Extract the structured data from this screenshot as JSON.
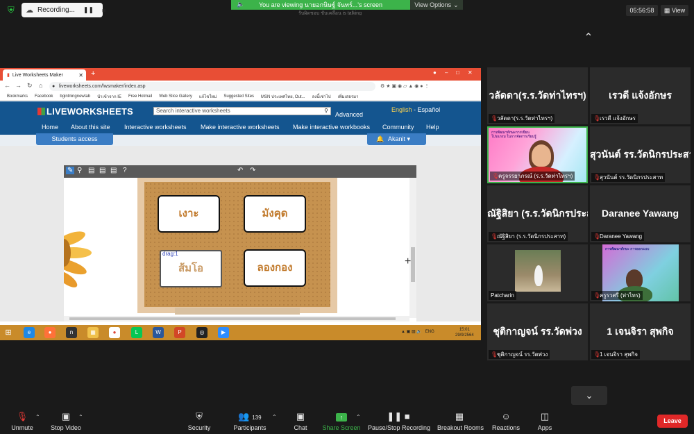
{
  "meeting": {
    "recording_label": "Recording...",
    "viewing_banner": "You are viewing นายอกนิษฐ์ จันทร์...'s screen",
    "view_options_label": "View Options",
    "peek_text": "รับผิดชอบ ขับเคลื่อน is talking",
    "timer": "05:56:58",
    "view_label": "View"
  },
  "browser": {
    "tab_title": "Live Worksheets Maker",
    "url": "liveworksheets.com/lwsmaker/index.asp",
    "bookmarks": [
      "Bookmarks",
      "Facebook",
      "bgintningnewtab",
      "นำเข้าจาก IE",
      "Free Hotmail",
      "Web Slice Gallery",
      "แก้ไขใหม่",
      "Suggested Sites",
      "MSN ประเทศไทย, Out...",
      "ลงนี้เช่าไป",
      "เพิ่มเสอรมา"
    ]
  },
  "site": {
    "logo": "LIVEWORKSHEETS",
    "search_placeholder": "Search interactive worksheets",
    "advanced": "Advanced",
    "lang_english": "English",
    "lang_sep": "-",
    "lang_spanish": "Español",
    "menu": [
      "Home",
      "About this site",
      "Interactive worksheets",
      "Make interactive worksheets",
      "Make interactive workbooks",
      "Community",
      "Help"
    ],
    "students_access": "Students access",
    "user": "Akanit"
  },
  "worksheet": {
    "cards": [
      "เงาะ",
      "มังคุด",
      "ส้มโอ",
      "ลองกอง"
    ],
    "drag_label": "drag:1"
  },
  "taskbar": {
    "tray": "ENG",
    "time": "15:01",
    "date": "29/9/2564"
  },
  "participants_tiles": [
    {
      "name": "วลัดดา(ร.ร.วัดท่าไทรฯ)",
      "caption": "วลัดดา(ร.ร.วัดท่าไทรฯ)"
    },
    {
      "name": "เรวดี แจ้งอักษร",
      "caption": "เรวดี แจ้งอักษร"
    },
    {
      "caption": "ครูจรรยาภรณ์ (ร.ร.วัดท่าไทรฯ)",
      "banner": "การพัฒนาทักษะการเขียนโปรแกรม ในการจัดการเรียนรู้"
    },
    {
      "name": "สุวนันต์ รร.วัดนิกรประสาท",
      "caption": "สุวนันต์ รร.วัดนิกรประสาท"
    },
    {
      "name": "ณัฐิสิยา (ร.ร.วัดนิกรประสาท)",
      "caption": "ณัฐิสิยา (ร.ร.วัดนิกรประสาท)"
    },
    {
      "name": "Daranee Yawang",
      "caption": "Daranee Yawang"
    },
    {
      "caption": "Patcharin"
    },
    {
      "caption": "ครูรวศรี (ท่าไทร)",
      "banner": "การพัฒนาทักษะ การออกแบบ"
    },
    {
      "name": "ชุติกาญจน์ รร.วัดพ่วง",
      "caption": "ชุติกาญจน์ รร.วัดพ่วง"
    },
    {
      "name": "1 เจนจิรา สุพกิจ",
      "caption": "1 เจนจิรา สุพกิจ"
    }
  ],
  "toolbar": {
    "unmute": "Unmute",
    "stop_video": "Stop Video",
    "security": "Security",
    "participants": "Participants",
    "participants_count": "139",
    "chat": "Chat",
    "share_screen": "Share Screen",
    "pause_recording": "Pause/Stop Recording",
    "breakout_rooms": "Breakout Rooms",
    "reactions": "Reactions",
    "apps": "Apps",
    "leave": "Leave"
  },
  "colors": {
    "zoom_green": "#3cb34a",
    "leave_red": "#e02828",
    "site_blue": "#14558f"
  }
}
